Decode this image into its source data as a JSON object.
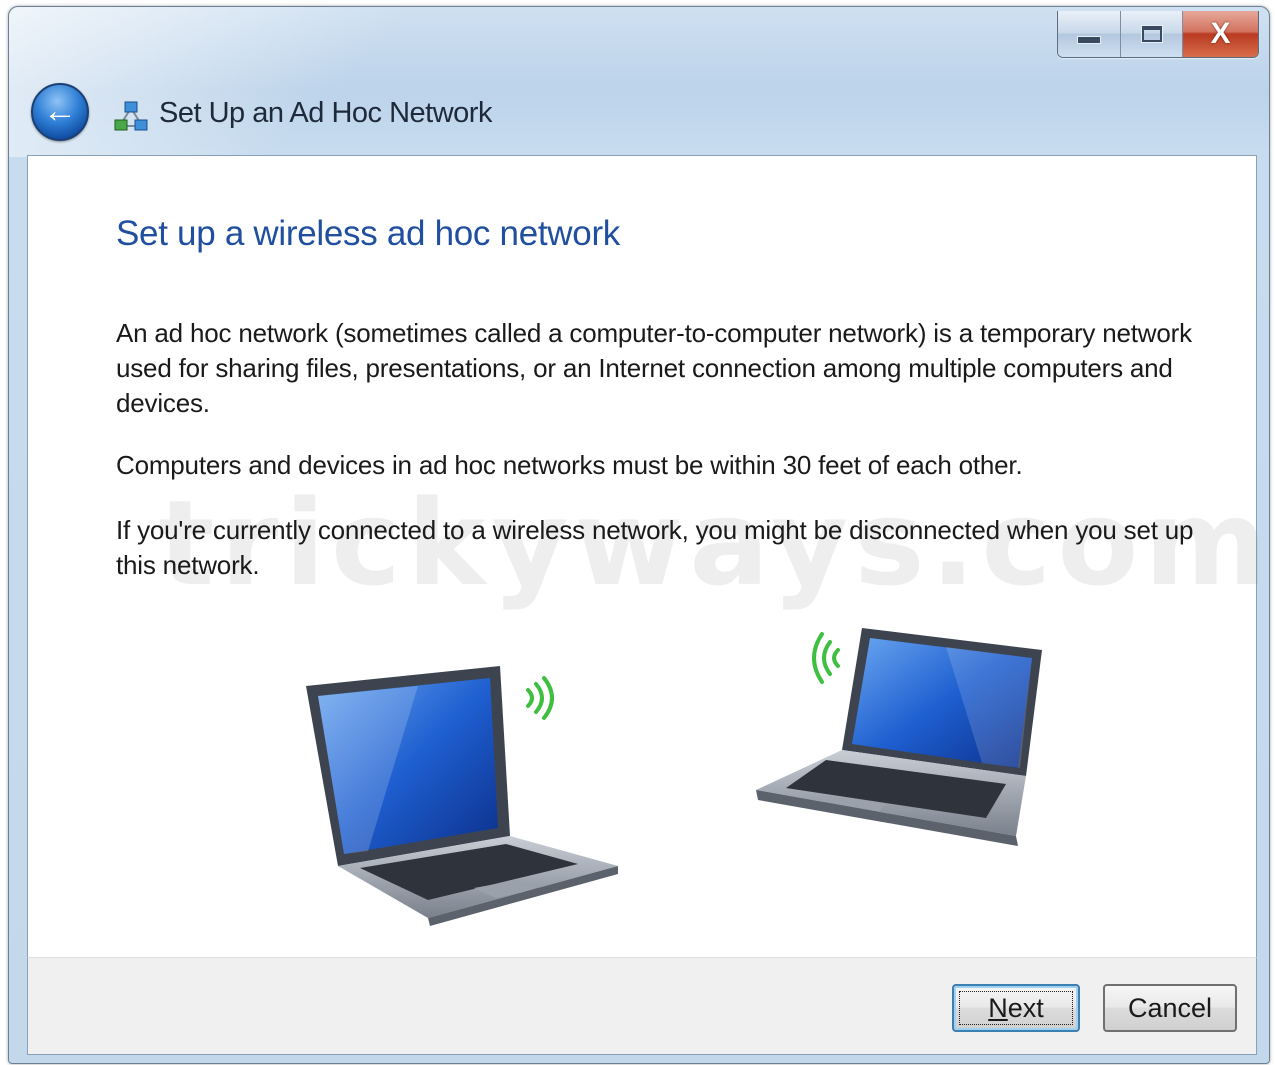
{
  "window": {
    "title": "Set Up an Ad Hoc Network",
    "caption_buttons": [
      "minimize",
      "maximize",
      "close"
    ],
    "close_glyph": "X"
  },
  "navigation": {
    "back_icon": "back-arrow-icon",
    "back_glyph": "←"
  },
  "content": {
    "heading": "Set up a wireless ad hoc network",
    "paragraph_1": "An ad hoc network (sometimes called a computer-to-computer network) is a temporary network used for sharing files, presentations, or an Internet connection among multiple computers and devices.",
    "paragraph_2": "Computers and devices in ad hoc networks must be within 30 feet of each other.",
    "paragraph_3": "If you're currently connected to a wireless network, you might be disconnected when you set up this network.",
    "watermark": "trickyways.com",
    "illustration_icons": [
      "laptop-icon",
      "wifi-signal-icon",
      "laptop-icon",
      "wifi-signal-icon"
    ]
  },
  "footer": {
    "next_label": "Next",
    "cancel_label": "Cancel"
  },
  "colors": {
    "heading": "#1f4f9e",
    "close_button": "#c9462a",
    "wifi_signal": "#3fbf3f",
    "next_focus": "#3c7fb1"
  }
}
